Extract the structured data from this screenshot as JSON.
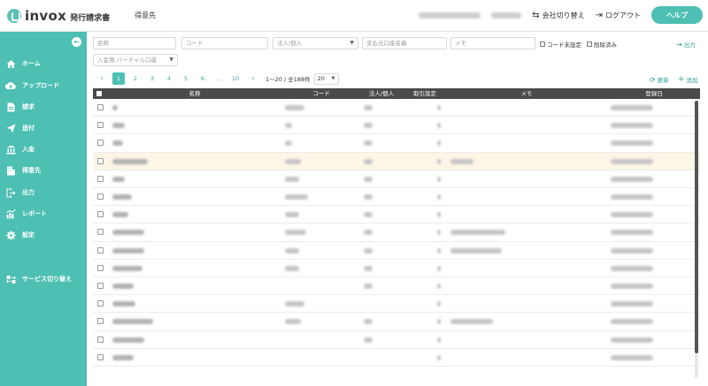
{
  "app": {
    "brand": "invox",
    "brand_sub": "発行請求書",
    "page_title": "得意先"
  },
  "header": {
    "company_switch": "会社切り替え",
    "logout": "ログアウト",
    "help": "ヘルプ"
  },
  "sidebar": {
    "items": [
      {
        "label": "ホーム",
        "icon": "home-icon"
      },
      {
        "label": "アップロード",
        "icon": "cloud-upload-icon"
      },
      {
        "label": "請求",
        "icon": "document-icon"
      },
      {
        "label": "送付",
        "icon": "send-icon"
      },
      {
        "label": "入金",
        "icon": "bank-icon"
      },
      {
        "label": "得意先",
        "icon": "building-icon"
      },
      {
        "label": "出力",
        "icon": "export-icon"
      },
      {
        "label": "レポート",
        "icon": "chart-icon"
      },
      {
        "label": "設定",
        "icon": "gear-icon"
      },
      {
        "label": "サービス切り替え",
        "icon": "switch-icon"
      }
    ]
  },
  "filters": {
    "name_placeholder": "名称",
    "code_placeholder": "コード",
    "type_placeholder": "法人/個人",
    "payer_placeholder": "支払元口座名義",
    "memo_placeholder": "メモ",
    "code_unset": "コード未設定",
    "deleted": "削除済み",
    "export": "出力",
    "virtual_account_placeholder": "入金用 バーチャル口座"
  },
  "pagination": {
    "pages": [
      "1",
      "2",
      "3",
      "4",
      "5",
      "6",
      "…",
      "10"
    ],
    "active_page": "1",
    "range_info": "1〜20 / 全188件",
    "per_page": "20"
  },
  "actions": {
    "refresh": "更新",
    "add": "追加"
  },
  "table": {
    "columns": [
      "名称",
      "コード",
      "法人/個人",
      "取引設定",
      "メモ",
      "登録日"
    ],
    "row_count": 15,
    "highlighted_row": 3
  },
  "colors": {
    "accent": "#4dbfb3",
    "header_dark": "#4a4a4a",
    "highlight_row": "#fcf6e6"
  }
}
